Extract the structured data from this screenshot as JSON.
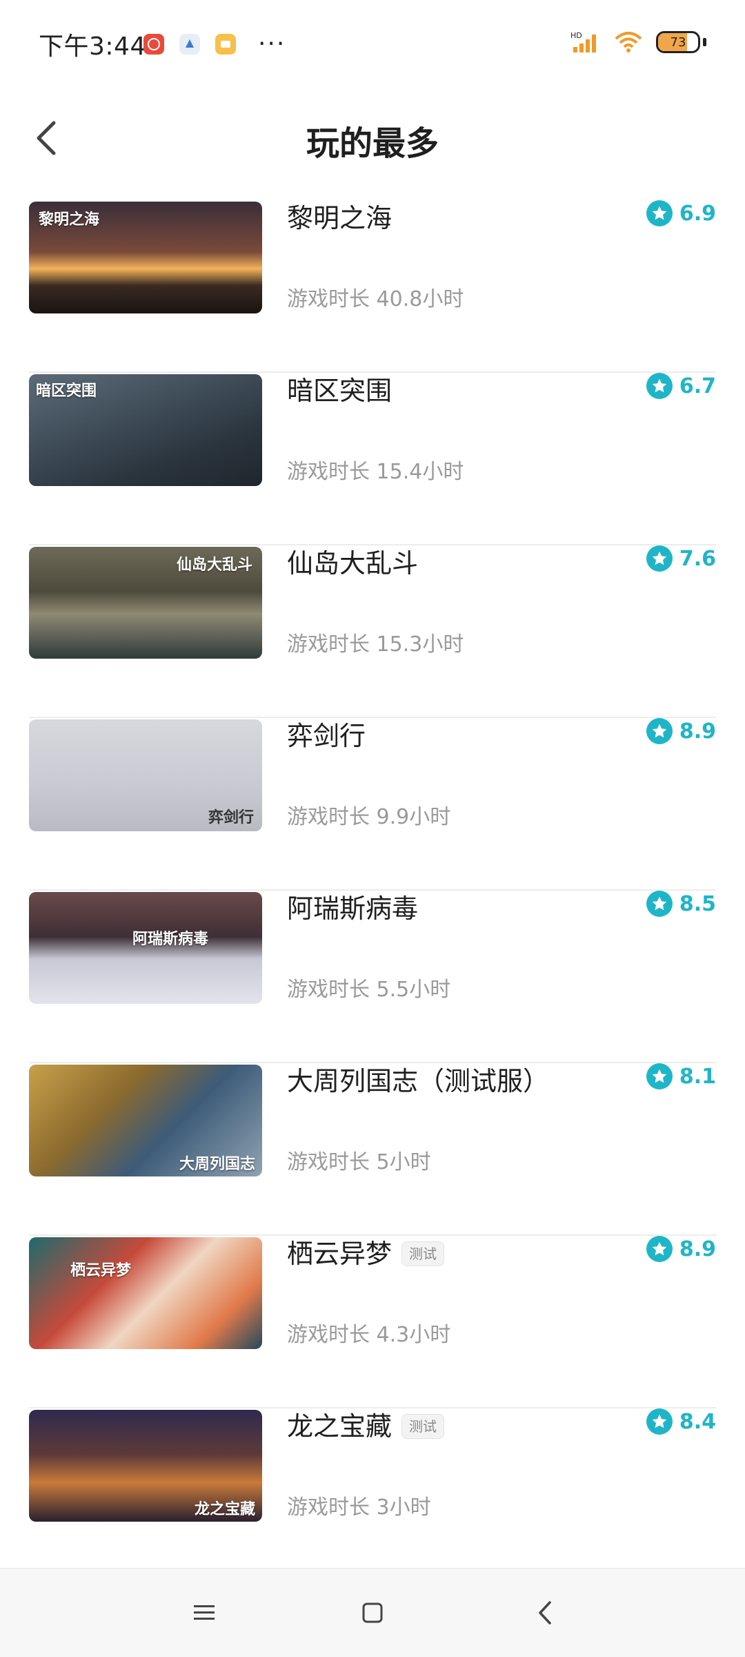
{
  "status_bar": {
    "time": "下午3:44",
    "more": "···",
    "battery": "73",
    "battery_level": 0.73,
    "network": "HD"
  },
  "header": {
    "title": "玩的最多"
  },
  "colors": {
    "accent": "#1fb5c8",
    "battery": "#f2a64b",
    "signal": "#f09a2b"
  },
  "games": [
    {
      "name": "黎明之海",
      "badge": "",
      "playtime": "游戏时长 40.8小时",
      "rating": "6.9",
      "caption": "黎明之海"
    },
    {
      "name": "暗区突围",
      "badge": "",
      "playtime": "游戏时长 15.4小时",
      "rating": "6.7",
      "caption": "暗区突围"
    },
    {
      "name": "仙岛大乱斗",
      "badge": "",
      "playtime": "游戏时长 15.3小时",
      "rating": "7.6",
      "caption": "仙岛大乱斗"
    },
    {
      "name": "弈剑行",
      "badge": "",
      "playtime": "游戏时长 9.9小时",
      "rating": "8.9",
      "caption": "弈剑行"
    },
    {
      "name": "阿瑞斯病毒",
      "badge": "",
      "playtime": "游戏时长 5.5小时",
      "rating": "8.5",
      "caption": "阿瑞斯病毒"
    },
    {
      "name": "大周列国志（测试服）",
      "badge": "",
      "playtime": "游戏时长 5小时",
      "rating": "8.1",
      "caption": "大周列国志"
    },
    {
      "name": "栖云异梦",
      "badge": "测试",
      "playtime": "游戏时长 4.3小时",
      "rating": "8.9",
      "caption": "栖云异梦"
    },
    {
      "name": "龙之宝藏",
      "badge": "测试",
      "playtime": "游戏时长 3小时",
      "rating": "8.4",
      "caption": "龙之宝藏"
    }
  ],
  "nav": {
    "menu_icon": "menu-icon",
    "home_icon": "home-icon",
    "back_icon": "back-icon"
  }
}
